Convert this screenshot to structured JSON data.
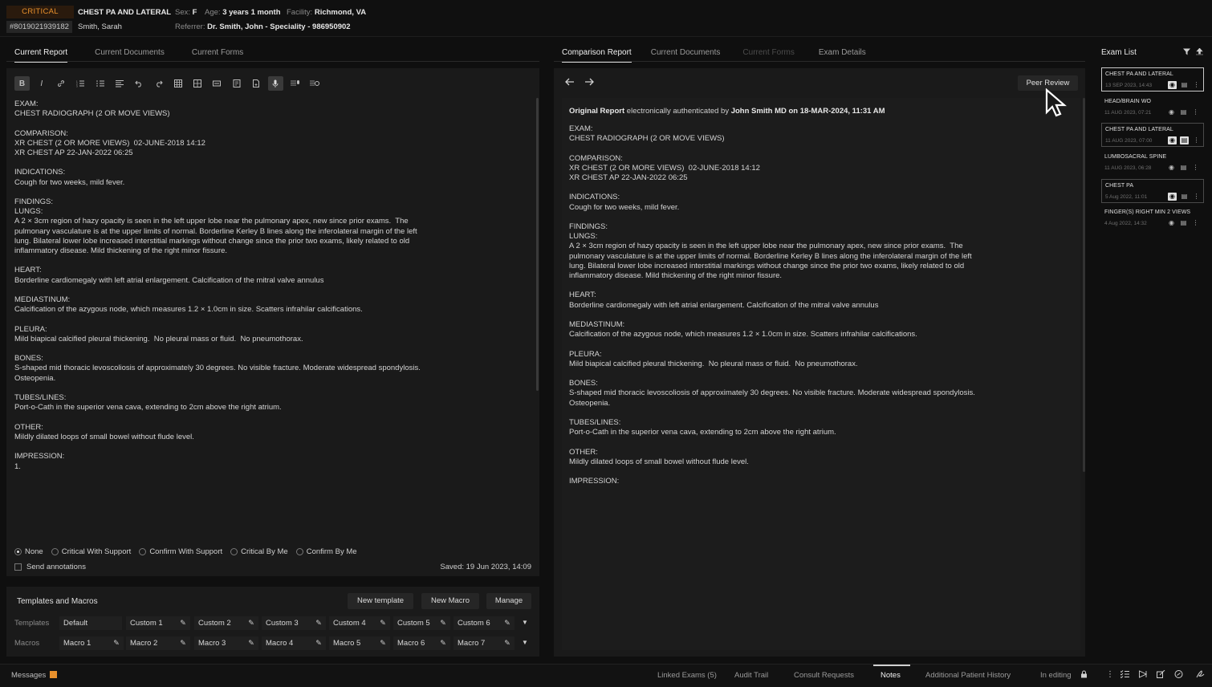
{
  "header": {
    "critical_label": "CRITICAL",
    "accession": "#8019021939182",
    "exam_title": "CHEST PA AND LATERAL",
    "patient_name": "Smith, Sarah",
    "sex_label": "Sex:",
    "sex_value": "F",
    "age_label": "Age:",
    "age_value": "3 years 1 month",
    "facility_label": "Facility:",
    "facility_value": "Richmond, VA",
    "referrer_label": "Referrer:",
    "referrer_value": "Dr. Smith, John - Speciality - 986950902"
  },
  "left_tabs": [
    "Current Report",
    "Current Documents",
    "Current Forms"
  ],
  "right_tabs": [
    "Comparison Report",
    "Current Documents",
    "Current Forms",
    "Exam Details"
  ],
  "toolbar_icons": [
    "bold-icon",
    "italic-icon",
    "link-icon",
    "ordered-list-icon",
    "bullet-list-icon",
    "align-icon",
    "undo-icon",
    "redo-icon",
    "table-icon",
    "grid-icon",
    "field-icon",
    "template-icon",
    "document-icon",
    "microphone-icon",
    "dictation-icon",
    "transcribe-icon"
  ],
  "current_report": "EXAM:\nCHEST RADIOGRAPH (2 OR MOVE VIEWS)\n\nCOMPARISON:\nXR CHEST (2 OR MORE VIEWS)  02-JUNE-2018 14:12\nXR CHEST AP 22-JAN-2022 06:25\n\nINDICATIONS:\nCough for two weeks, mild fever.\n\nFINDINGS:\nLUNGS:\nA 2 × 3cm region of hazy opacity is seen in the left upper lobe near the pulmonary apex, new since prior exams.  The\npulmonary vasculature is at the upper limits of normal. Borderline Kerley B lines along the inferolateral margin of the left\nlung. Bilateral lower lobe increased interstitial markings without change since the prior two exams, likely related to old\ninflammatory disease. Mild thickening of the right minor fissure.\n\nHEART:\nBorderline cardiomegaly with left atrial enlargement. Calcification of the mitral valve annulus\n\nMEDIASTINUM:\nCalcification of the azygous node, which measures 1.2 × 1.0cm in size. Scatters infrahilar calcifications.\n\nPLEURA:\nMild biapical calcified pleural thickening.  No pleural mass or fluid.  No pneumothorax.\n\nBONES:\nS-shaped mid thoracic levoscoliosis of approximately 30 degrees. No visible fracture. Moderate widespread spondylosis.\nOsteopenia.\n\nTUBES/LINES:\nPort-o-Cath in the superior vena cava, extending to 2cm above the right atrium.\n\nOTHER:\nMildly dilated loops of small bowel without flude level.\n\nIMPRESSION:\n1.",
  "criticality_options": [
    "None",
    "Critical With Support",
    "Confirm With Support",
    "Critical By Me",
    "Confirm By Me"
  ],
  "criticality_selected": "None",
  "send_annotations_label": "Send annotations",
  "saved_text": "Saved: 19 Jun 2023, 14:09",
  "templates_macros": {
    "title": "Templates and Macros",
    "new_template": "New template",
    "new_macro": "New Macro",
    "manage": "Manage",
    "templates_label": "Templates",
    "macros_label": "Macros",
    "templates": [
      "Default",
      "Custom 1",
      "Custom 2",
      "Custom 3",
      "Custom 4",
      "Custom 5",
      "Custom 6"
    ],
    "macros": [
      "Macro 1",
      "Macro 2",
      "Macro 3",
      "Macro 4",
      "Macro 5",
      "Macro 6",
      "Macro 7"
    ]
  },
  "comparison": {
    "peer_review": "Peer Review",
    "auth_prefix": "Original Report",
    "auth_middle": "electronically authenticated by",
    "auth_by": "John Smith MD on 18-MAR-2024, 11:31 AM",
    "report": "EXAM:\nCHEST RADIOGRAPH (2 OR MOVE VIEWS)\n\nCOMPARISON:\nXR CHEST (2 OR MORE VIEWS)  02-JUNE-2018 14:12\nXR CHEST AP 22-JAN-2022 06:25\n\nINDICATIONS:\nCough for two weeks, mild fever.\n\nFINDINGS:\nLUNGS:\nA 2 × 3cm region of hazy opacity is seen in the left upper lobe near the pulmonary apex, new since prior exams.  The\npulmonary vasculature is at the upper limits of normal. Borderline Kerley B lines along the inferolateral margin of the left\nlung. Bilateral lower lobe increased interstitial markings without change since the prior two exams, likely related to old\ninflammatory disease. Mild thickening of the right minor fissure.\n\nHEART:\nBorderline cardiomegaly with left atrial enlargement. Calcification of the mitral valve annulus\n\nMEDIASTINUM:\nCalcification of the azygous node, which measures 1.2 × 1.0cm in size. Scatters infrahilar calcifications.\n\nPLEURA:\nMild biapical calcified pleural thickening.  No pleural mass or fluid.  No pneumothorax.\n\nBONES:\nS-shaped mid thoracic levoscoliosis of approximately 30 degrees. No visible fracture. Moderate widespread spondylosis.\nOsteopenia.\n\nTUBES/LINES:\nPort-o-Cath in the superior vena cava, extending to 2cm above the right atrium.\n\nOTHER:\nMildly dilated loops of small bowel without flude level.\n\nIMPRESSION:"
  },
  "exam_list": {
    "title": "Exam List",
    "items": [
      {
        "name": "CHEST PA AND LATERAL",
        "date": "13 SEP 2023, 14:43"
      },
      {
        "name": "HEAD/BRAIN WO",
        "date": "11 AUG 2023, 07:21"
      },
      {
        "name": "CHEST PA AND LATERAL",
        "date": "11 AUG 2023, 07:00"
      },
      {
        "name": "LUMBOSACRAL SPINE",
        "date": "11 AUG 2023, 06:28"
      },
      {
        "name": "CHEST PA",
        "date": "5 Aug 2022, 11:01"
      },
      {
        "name": "FINGER(S) RIGHT MIN 2 VIEWS",
        "date": "4 Aug 2022, 14:32"
      }
    ]
  },
  "bottom_bar": {
    "messages": "Messages",
    "linked_exams": "Linked Exams (5)",
    "audit_trail": "Audit Trail",
    "consult_requests": "Consult Requests",
    "notes": "Notes",
    "additional_history": "Additional Patient History",
    "in_editing": "In editing"
  },
  "colors": {
    "critical": "#e8902c",
    "messages_badge": "#e8902c",
    "background": "#0f0f0f",
    "panel": "#1a1a1a"
  }
}
